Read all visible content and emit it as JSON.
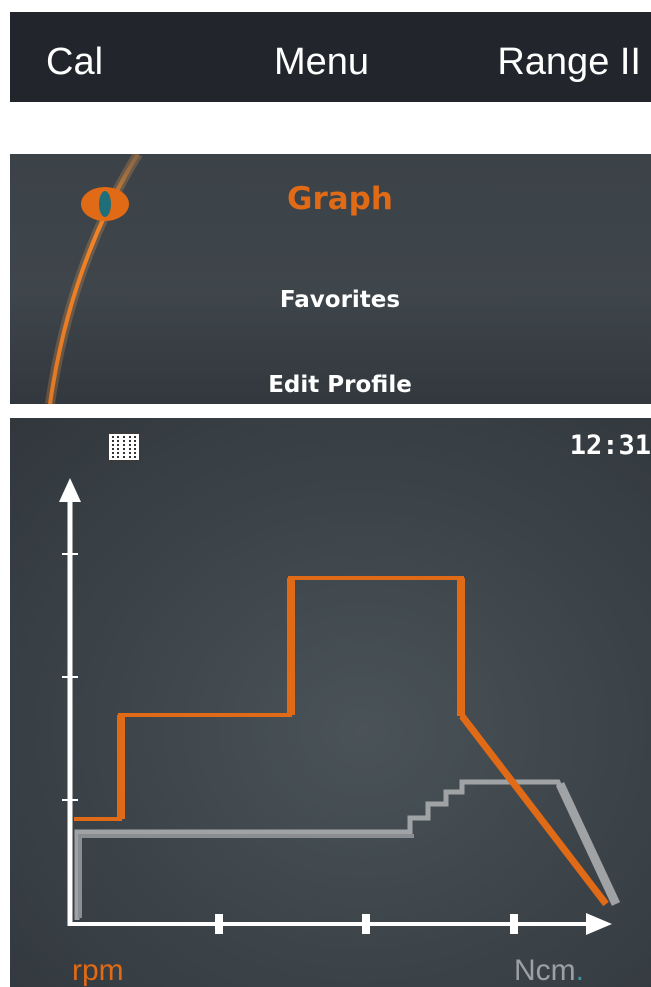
{
  "topbar": {
    "left_label": "Cal",
    "center_label": "Menu",
    "right_label": "Range II"
  },
  "menu": {
    "items": [
      {
        "label": "Graph",
        "active": true
      },
      {
        "label": "Favorites",
        "active": false
      },
      {
        "label": "Edit Profile",
        "active": false
      }
    ],
    "selector_icon": "eye-icon"
  },
  "graph": {
    "clock": "12:31",
    "list_icon": "list-icon",
    "y_unit_label": "rpm",
    "x_unit_label": "Ncm",
    "x_unit_dot": ".",
    "colors": {
      "rpm": "#e06a16",
      "ncm": "#a0a3a6",
      "axis": "#ffffff"
    }
  }
}
